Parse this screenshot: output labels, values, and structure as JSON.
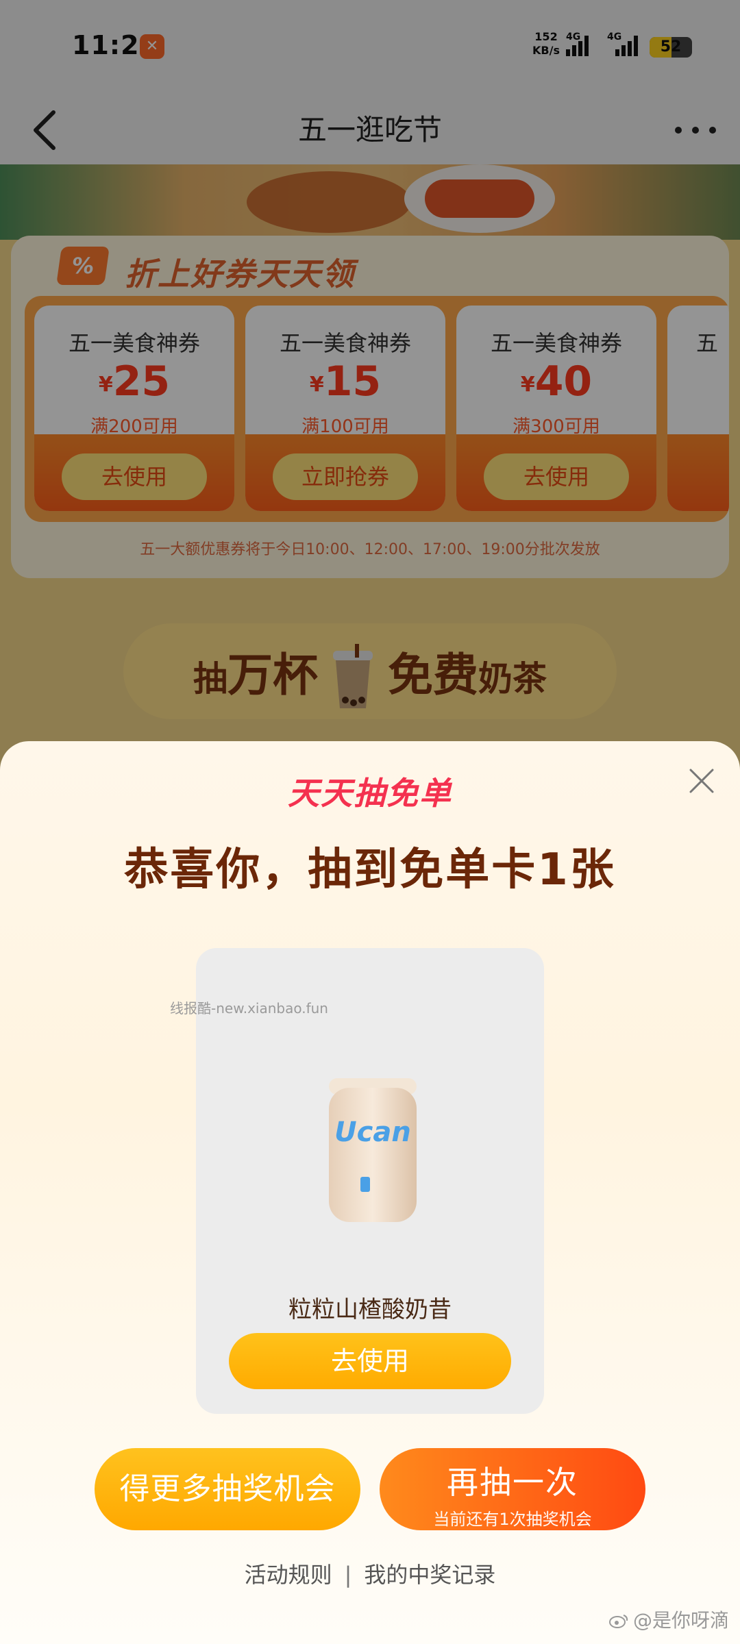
{
  "status_bar": {
    "time": "11:21",
    "app_badge_icon": "app-logo-icon",
    "net_speed_value": "152",
    "net_speed_unit": "KB/s",
    "signal1_label": "4G",
    "signal2_label": "4G",
    "battery": "52"
  },
  "nav": {
    "title": "五一逛吃节"
  },
  "coupons": {
    "header_badge": "%",
    "header": "折上好券天天领",
    "items": [
      {
        "name": "五一美食神券",
        "currency": "¥",
        "amount": "25",
        "condition": "满200可用",
        "action": "去使用"
      },
      {
        "name": "五一美食神券",
        "currency": "¥",
        "amount": "15",
        "condition": "满100可用",
        "action": "立即抢券"
      },
      {
        "name": "五一美食神券",
        "currency": "¥",
        "amount": "40",
        "condition": "满300可用",
        "action": "去使用"
      },
      {
        "name": "五",
        "currency": "",
        "amount": "",
        "condition": "",
        "action": ""
      }
    ],
    "note": "五一大额优惠券将于今日10:00、12:00、17:00、19:00分批次发放"
  },
  "tea_banner": {
    "part1_small": "抽",
    "part1": "万杯",
    "part2": "免费",
    "part2_small": "奶茶"
  },
  "sheet": {
    "brand": "天天抽免单",
    "title": "恭喜你，抽到免单卡1张",
    "watermark": "线报酷-new.xianbao.fun",
    "prize": {
      "drink_brand": "Ucan",
      "name": "粒粒山楂酸奶昔",
      "action": "去使用"
    },
    "more_chances": "得更多抽奖机会",
    "draw_again": "再抽一次",
    "draw_again_sub": "当前还有1次抽奖机会",
    "rules": "活动规则",
    "separator": "|",
    "records": "我的中奖记录",
    "weibo_tag": "@是你呀滴"
  },
  "colors": {
    "accent_yellow": "#ffb300",
    "accent_orange": "#ff5a14",
    "brand_red": "#f4314f",
    "title_brown": "#6b2708"
  }
}
